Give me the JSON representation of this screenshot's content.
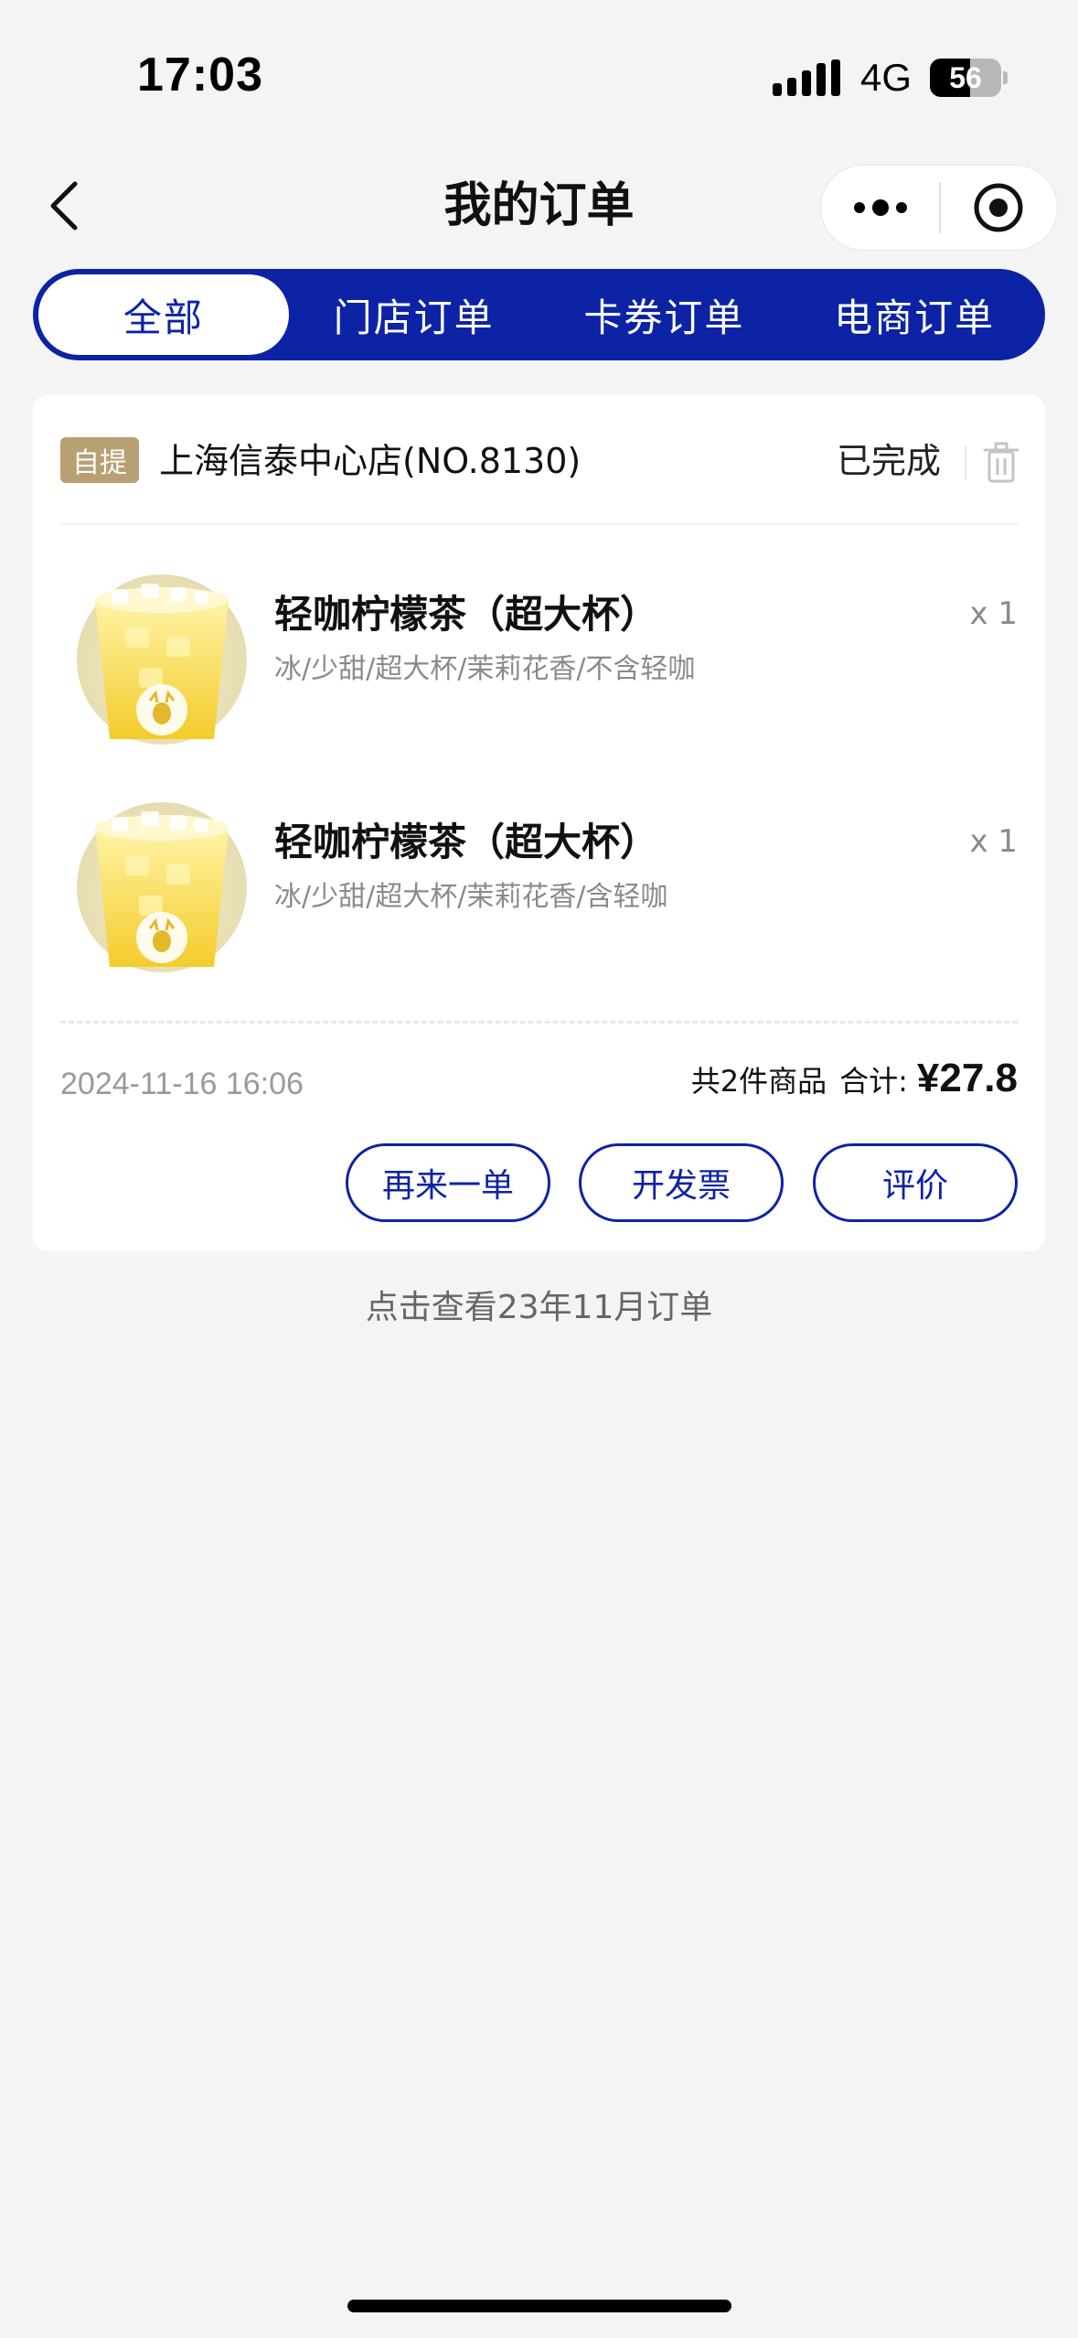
{
  "status_bar": {
    "time": "17:03",
    "network": "4G",
    "battery": "56",
    "battery_level": 0.56
  },
  "nav": {
    "title": "我的订单",
    "back_icon": "chevron-left-icon",
    "more_icon": "more-dots-icon",
    "close_icon": "target-circle-icon"
  },
  "tabs": [
    {
      "label": "全部",
      "active": true
    },
    {
      "label": "门店订单",
      "active": false
    },
    {
      "label": "卡券订单",
      "active": false
    },
    {
      "label": "电商订单",
      "active": false
    }
  ],
  "order": {
    "tag": "自提",
    "store": "上海信泰中心店(NO.8130)",
    "status": "已完成",
    "items": [
      {
        "name": "轻咖柠檬茶（超大杯）",
        "spec": "冰/少甜/超大杯/茉莉花香/不含轻咖",
        "qty": "x 1"
      },
      {
        "name": "轻咖柠檬茶（超大杯）",
        "spec": "冰/少甜/超大杯/茉莉花香/含轻咖",
        "qty": "x 1"
      }
    ],
    "time": "2024-11-16 16:06",
    "count_text": "共2件商品",
    "total_label": "合计:",
    "total": "¥27.8",
    "buttons": {
      "reorder": "再来一单",
      "invoice": "开发票",
      "review": "评价"
    }
  },
  "history_link": "点击查看23年11月订单",
  "colors": {
    "brand_blue": "#0d23a6",
    "tag_bg": "#b99f74",
    "background": "#f4f4f4"
  }
}
